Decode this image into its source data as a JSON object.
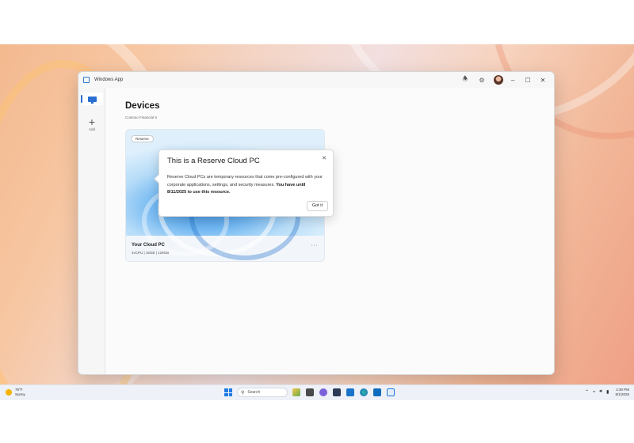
{
  "window": {
    "title": "Windows App"
  },
  "sidebar": {
    "items": [
      {
        "label": "",
        "icon": "monitor-icon",
        "selected": true
      },
      {
        "label": "Add",
        "icon": "plus-icon",
        "selected": false
      }
    ]
  },
  "main": {
    "title": "Devices",
    "org": "Contoso Financial S"
  },
  "card": {
    "badge": "Reserve",
    "name": "Your Cloud PC",
    "specs": "4vCPU | 16GB | 128GB",
    "more": "···"
  },
  "popup": {
    "title": "This is a Reserve Cloud PC",
    "body": "Reserve Cloud PCs are temporary resources that come pre-configured with your corporate applications, settings, and security measures.",
    "body_bold": "You have until 8/11/2025 to use this resource.",
    "button": "Got it"
  },
  "taskbar": {
    "weather_temp": "78°F",
    "weather_desc": "Sunny",
    "search_label": "Search",
    "time": "2:30 PM",
    "date": "8/1/2025"
  },
  "colors": {
    "accent": "#2a6fd1"
  }
}
